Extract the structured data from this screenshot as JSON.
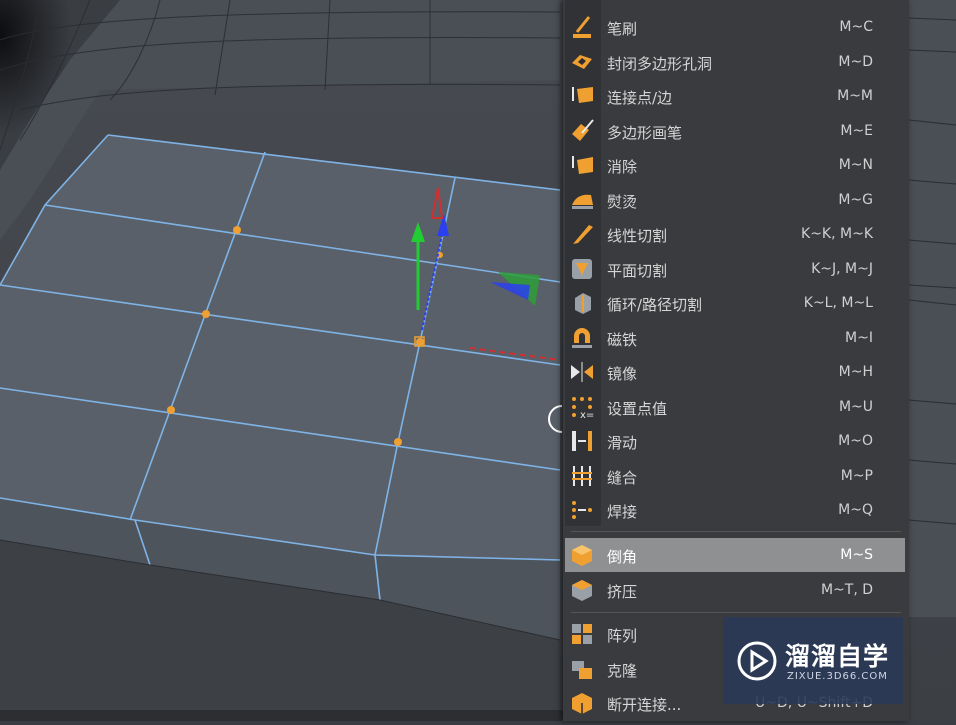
{
  "menu": {
    "items": [
      {
        "label": "笔刷",
        "shortcut": "M~C",
        "icon": "brush-icon"
      },
      {
        "label": "封闭多边形孔洞",
        "shortcut": "M~D",
        "icon": "close-hole-icon"
      },
      {
        "label": "连接点/边",
        "shortcut": "M~M",
        "icon": "connect-icon"
      },
      {
        "label": "多边形画笔",
        "shortcut": "M~E",
        "icon": "polygon-pen-icon"
      },
      {
        "label": "消除",
        "shortcut": "M~N",
        "icon": "dissolve-icon"
      },
      {
        "label": "熨烫",
        "shortcut": "M~G",
        "icon": "iron-icon"
      },
      {
        "label": "线性切割",
        "shortcut": "K~K, M~K",
        "icon": "knife-icon"
      },
      {
        "label": "平面切割",
        "shortcut": "K~J, M~J",
        "icon": "plane-cut-icon"
      },
      {
        "label": "循环/路径切割",
        "shortcut": "K~L, M~L",
        "icon": "loop-cut-icon"
      },
      {
        "label": "磁铁",
        "shortcut": "M~I",
        "icon": "magnet-icon"
      },
      {
        "label": "镜像",
        "shortcut": "M~H",
        "icon": "mirror-icon"
      },
      {
        "label": "设置点值",
        "shortcut": "M~U",
        "icon": "set-point-icon"
      },
      {
        "label": "滑动",
        "shortcut": "M~O",
        "icon": "slide-icon"
      },
      {
        "label": "缝合",
        "shortcut": "M~P",
        "icon": "stitch-icon"
      },
      {
        "label": "焊接",
        "shortcut": "M~Q",
        "icon": "weld-icon"
      }
    ],
    "group2": [
      {
        "label": "倒角",
        "shortcut": "M~S",
        "icon": "bevel-icon",
        "selected": true
      },
      {
        "label": "挤压",
        "shortcut": "M~T, D",
        "icon": "extrude-icon"
      }
    ],
    "group3": [
      {
        "label": "阵列",
        "shortcut": "",
        "icon": "array-icon"
      },
      {
        "label": "克隆",
        "shortcut": "",
        "icon": "clone-icon"
      },
      {
        "label": "断开连接...",
        "shortcut": "U~D, U~Shift+D",
        "icon": "disconnect-icon"
      }
    ]
  },
  "watermark": {
    "title": "溜溜自学",
    "url": "ZIXUE.3D66.COM"
  },
  "colors": {
    "accent_orange": "#f0a030",
    "selection_edge": "#7fb3e6",
    "menu_bg": "#393b3e",
    "highlight": "#8f9092"
  }
}
